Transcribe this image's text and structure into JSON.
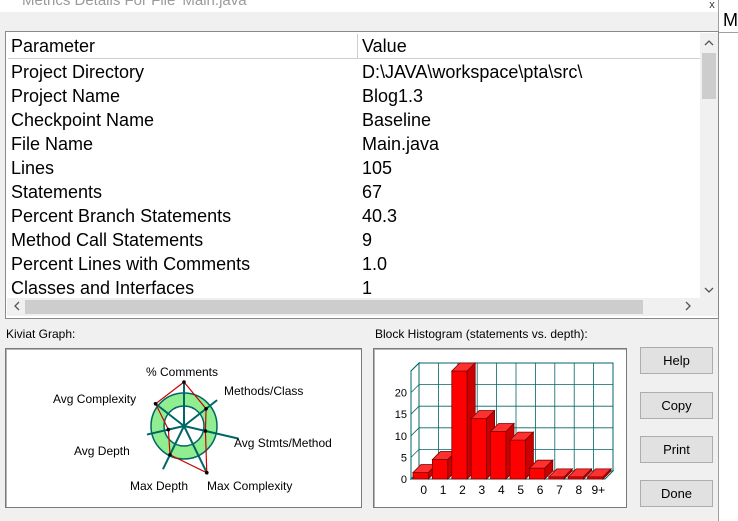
{
  "window": {
    "title": "Metrics Details For File 'Main.java'",
    "side_char": "M",
    "close_glyph": "x"
  },
  "table": {
    "headers": [
      "Parameter",
      "Value"
    ],
    "rows": [
      [
        "Project Directory",
        "D:\\JAVA\\workspace\\pta\\src\\"
      ],
      [
        "Project Name",
        "Blog1.3"
      ],
      [
        "Checkpoint Name",
        "Baseline"
      ],
      [
        "File Name",
        "Main.java"
      ],
      [
        "Lines",
        "105"
      ],
      [
        "Statements",
        "67"
      ],
      [
        "Percent Branch Statements",
        "40.3"
      ],
      [
        "Method Call Statements",
        "9"
      ],
      [
        "Percent Lines with Comments",
        "1.0"
      ],
      [
        "Classes and Interfaces",
        "1"
      ]
    ],
    "scroll": {
      "up": "^",
      "down": "v",
      "left": "<",
      "right": ">"
    }
  },
  "kiviat": {
    "label": "Kiviat Graph:",
    "axes": [
      "% Comments",
      "Methods/Class",
      "Avg Stmts/Method",
      "Max Complexity",
      "Max Depth",
      "Avg Depth",
      "Avg Complexity"
    ],
    "normal_range_color": "#90ee90",
    "value_color": "#cc0000"
  },
  "histogram": {
    "label": "Block Histogram (statements vs. depth):",
    "bar_color": "#ff0000"
  },
  "buttons": {
    "help": "Help",
    "copy": "Copy",
    "print": "Print",
    "done": "Done"
  },
  "chart_data": {
    "type": "bar",
    "title": "",
    "xlabel": "",
    "ylabel": "",
    "categories": [
      "0",
      "1",
      "2",
      "3",
      "4",
      "5",
      "6",
      "7",
      "8",
      "9+"
    ],
    "values": [
      1.5,
      4.5,
      25,
      14,
      11,
      9,
      2.5,
      0.5,
      0.5,
      0.5
    ],
    "ylim": [
      0,
      25
    ],
    "yticks": [
      "0",
      "5",
      "10",
      "15",
      "20"
    ],
    "grid": true,
    "style": "3d"
  }
}
